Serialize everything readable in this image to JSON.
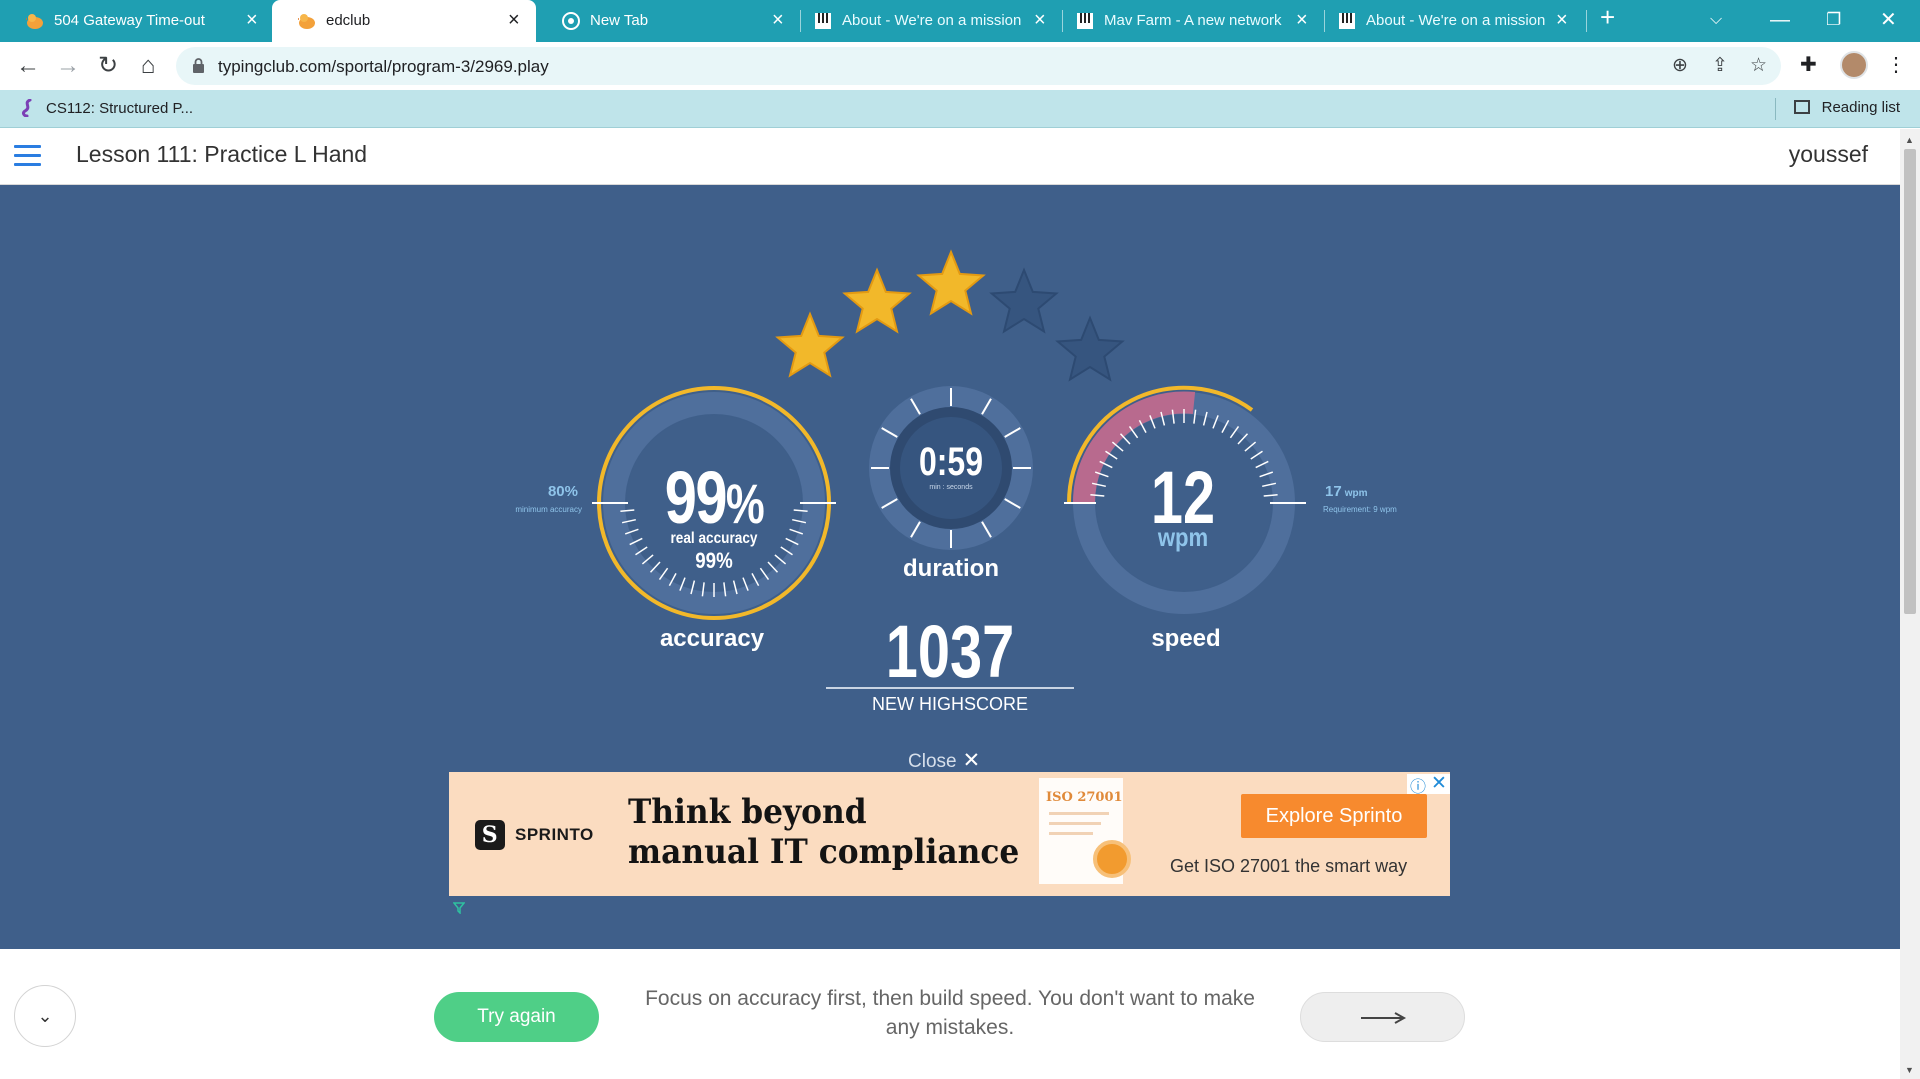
{
  "browser": {
    "tabs": [
      {
        "title": "504 Gateway Time-out",
        "icon": "edclub-duck-icon",
        "active": false
      },
      {
        "title": "edclub",
        "icon": "edclub-duck-icon",
        "active": true
      },
      {
        "title": "New Tab",
        "icon": "chrome-icon",
        "active": false
      },
      {
        "title": "About - We're on a mission",
        "icon": "piano-keys-icon",
        "active": false
      },
      {
        "title": "Mav Farm - A new network",
        "icon": "piano-keys-icon",
        "active": false
      },
      {
        "title": "About - We're on a mission",
        "icon": "piano-keys-icon",
        "active": false
      }
    ],
    "url": "typingclub.com/sportal/program-3/2969.play",
    "bookmark": "CS112: Structured P...",
    "reading_list": "Reading list"
  },
  "header": {
    "lesson_title": "Lesson 111: Practice L Hand",
    "user": "youssef"
  },
  "results": {
    "stars": {
      "earned": 3,
      "total": 5
    },
    "accuracy": {
      "value": "99",
      "unit": "%",
      "real_label": "real accuracy",
      "real_value": "99%",
      "label": "accuracy",
      "minimum_value": "80%",
      "minimum_label": "minimum accuracy",
      "fraction": 0.99
    },
    "duration": {
      "value": "0:59",
      "unit": "min : seconds",
      "label": "duration"
    },
    "speed": {
      "value": "12",
      "unit": "wpm",
      "label": "speed",
      "requirement_value": "17",
      "requirement_unit": "wpm",
      "requirement_label": "Requirement: 9 wpm"
    },
    "highscore": {
      "value": "1037",
      "label": "NEW HIGHSCORE"
    },
    "close_label": "Close"
  },
  "ad": {
    "brand": "SPRINTO",
    "headline_line1": "Think beyond",
    "headline_line2": "manual IT compliance",
    "cert_title": "ISO 27001",
    "cta": "Explore Sprinto",
    "tagline": "Get ISO 27001 the smart way"
  },
  "footer": {
    "try_again": "Try again",
    "tip": "Focus on accuracy first, then build speed. You don't want to make any mistakes."
  },
  "colors": {
    "page_bg": "#3f5f8a",
    "gauge_ring": "#4f6f9c",
    "accent_yellow": "#f2b82a",
    "star_dim": "#36557f",
    "try_again": "#4fcf87",
    "speed_fill": "#b86a8e"
  }
}
